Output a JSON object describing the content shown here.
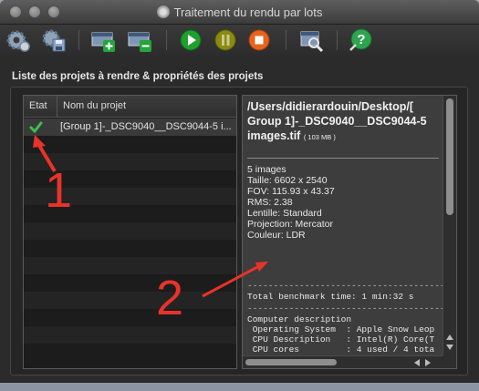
{
  "window": {
    "title": "Traitement du rendu par lots"
  },
  "toolbar": {
    "buttons": [
      {
        "name": "settings-gear-button",
        "icon": "gear-icon"
      },
      {
        "name": "save-button",
        "icon": "disk-save-icon"
      },
      {
        "name": "add-project-button",
        "icon": "add-plus-icon"
      },
      {
        "name": "remove-project-button",
        "icon": "remove-minus-icon"
      },
      {
        "name": "start-button",
        "icon": "play-icon"
      },
      {
        "name": "pause-button",
        "icon": "pause-icon"
      },
      {
        "name": "stop-button",
        "icon": "stop-icon"
      },
      {
        "name": "preview-button",
        "icon": "magnifier-icon"
      },
      {
        "name": "help-button",
        "icon": "help-question-icon"
      }
    ],
    "colors": {
      "play": "#1fa02e",
      "pause": "#8a8a12",
      "stop": "#e8641a",
      "help": "#2ea44f"
    }
  },
  "section": {
    "title": "Liste des projets à rendre & propriétés des projets"
  },
  "project_list": {
    "columns": {
      "etat": "Etat",
      "nom": "Nom du projet"
    },
    "rows": [
      {
        "status_icon": "check-icon",
        "name": "[Group 1]-_DSC9040__DSC9044-5 i..."
      }
    ]
  },
  "details": {
    "path_lines": [
      "/Users/didierardouin/Desktop/[",
      "Group 1]-_DSC9040__DSC9044-5",
      "images.tif"
    ],
    "file_size": "( 103 MB )",
    "info": [
      "5 images",
      "Taille: 6602 x 2540",
      "FOV: 115.93 x 43.37",
      "RMS: 2.38",
      "Lentille: Standard",
      "Projection: Mercator",
      "Couleur: LDR"
    ],
    "dashes": "--------------------------------------",
    "benchmark": "Total benchmark time: 1 min:32 s",
    "computer_lines": [
      "Computer description",
      " Operating System  : Apple Snow Leop",
      " CPU Description   : Intel(R) Core(T",
      " CPU cores         : 4 used / 4 tota"
    ]
  },
  "annotations": {
    "label_1": "1",
    "label_2": "2",
    "color": "#e8332a"
  }
}
